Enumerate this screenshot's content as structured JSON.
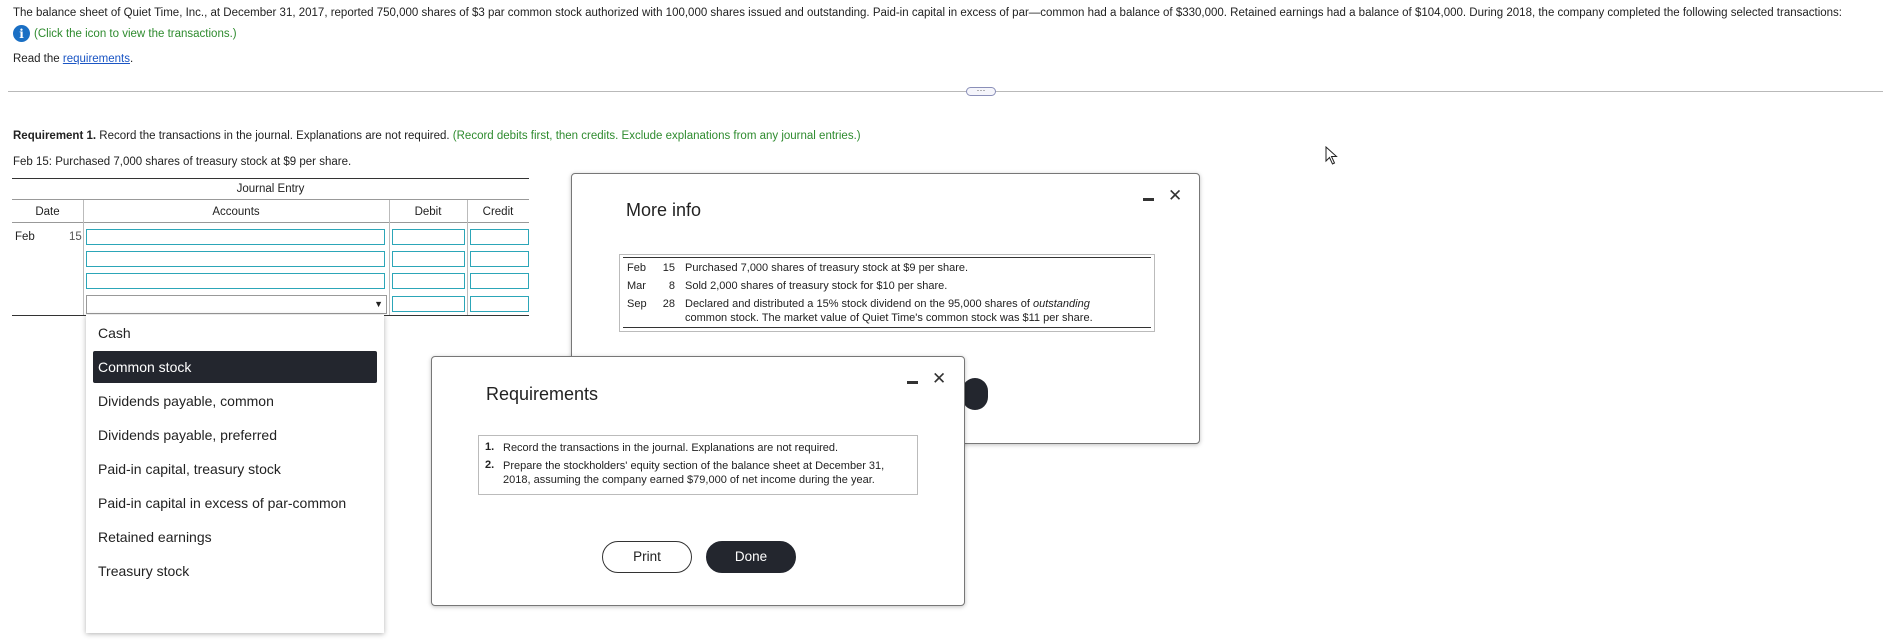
{
  "intro": {
    "text": "The balance sheet of Quiet Time, Inc., at December 31, 2017, reported 750,000 shares of $3 par common stock authorized with 100,000 shares issued and outstanding. Paid-in capital in excess of par—common had a balance of $330,000. Retained earnings had a balance of $104,000. During 2018, the company completed the following selected transactions:",
    "click_hint": "(Click the icon to view the transactions.)",
    "info_icon": "info-icon",
    "read_prefix": "Read the ",
    "read_link": "requirements",
    "read_suffix": "."
  },
  "divider": {
    "handle": "···"
  },
  "requirement": {
    "label": "Requirement 1.",
    "text": " Record the transactions in the journal. Explanations are not required. ",
    "hint": "(Record debits first, then credits. Exclude explanations from any journal entries.)",
    "transaction": "Feb 15: Purchased 7,000 shares of treasury stock at $9 per share."
  },
  "journal": {
    "title": "Journal Entry",
    "headers": {
      "date": "Date",
      "accounts": "Accounts",
      "debit": "Debit",
      "credit": "Credit"
    },
    "date_month": "Feb",
    "date_day": "15",
    "dropdown_arrow": "▼"
  },
  "account_dropdown": {
    "options": [
      "Cash",
      "Common stock",
      "Dividends payable, common",
      "Dividends payable, preferred",
      "Paid-in capital, treasury stock",
      "Paid-in capital in excess of par-common",
      "Retained earnings",
      "Treasury stock"
    ],
    "highlighted": "Common stock"
  },
  "more_info": {
    "title": "More info",
    "minimize": "minimize-icon",
    "close": "✕",
    "rows": [
      {
        "month": "Feb",
        "day": "15",
        "text": "Purchased 7,000 shares of treasury stock at $9 per share."
      },
      {
        "month": "Mar",
        "day": "8",
        "text": "Sold 2,000 shares of treasury stock for $10 per share."
      },
      {
        "month": "Sep",
        "day": "28",
        "text_a": "Declared and distributed a 15% stock dividend on the 95,000 shares of ",
        "text_em": "outstanding",
        "text_b": "common stock. The market value of Quiet Time's common stock was $11 per share."
      }
    ]
  },
  "requirements_dialog": {
    "title": "Requirements",
    "close": "✕",
    "items": [
      {
        "num": "1.",
        "text": "Record the transactions in the journal. Explanations are not required."
      },
      {
        "num": "2.",
        "text": "Prepare the stockholders' equity section of the balance sheet at December 31, 2018, assuming the company earned $79,000 of net income during the year."
      }
    ],
    "print_label": "Print",
    "done_label": "Done"
  }
}
